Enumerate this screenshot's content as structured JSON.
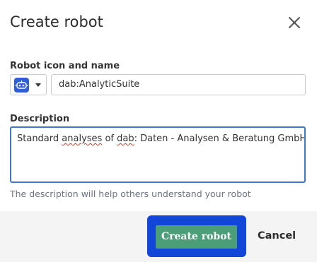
{
  "dialog": {
    "title": "Create robot",
    "close_icon": "close-icon"
  },
  "name_section": {
    "label": "Robot icon and name",
    "icon": "robot-icon",
    "icon_color": "#2f5fd7",
    "name_value": "dab:AnalyticSuite"
  },
  "description_section": {
    "label": "Description",
    "text_before": "Standard ",
    "text_misspelled_1": "analyses",
    "text_middle": " of ",
    "text_misspelled_2": "dab",
    "text_after": ": Daten - Analysen & Beratung GmbH.",
    "help_text": "The description will help others understand your robot"
  },
  "footer": {
    "create_label": "Create robot",
    "cancel_label": "Cancel",
    "create_color": "#4a9e78",
    "focus_ring_color": "#1146d8"
  }
}
